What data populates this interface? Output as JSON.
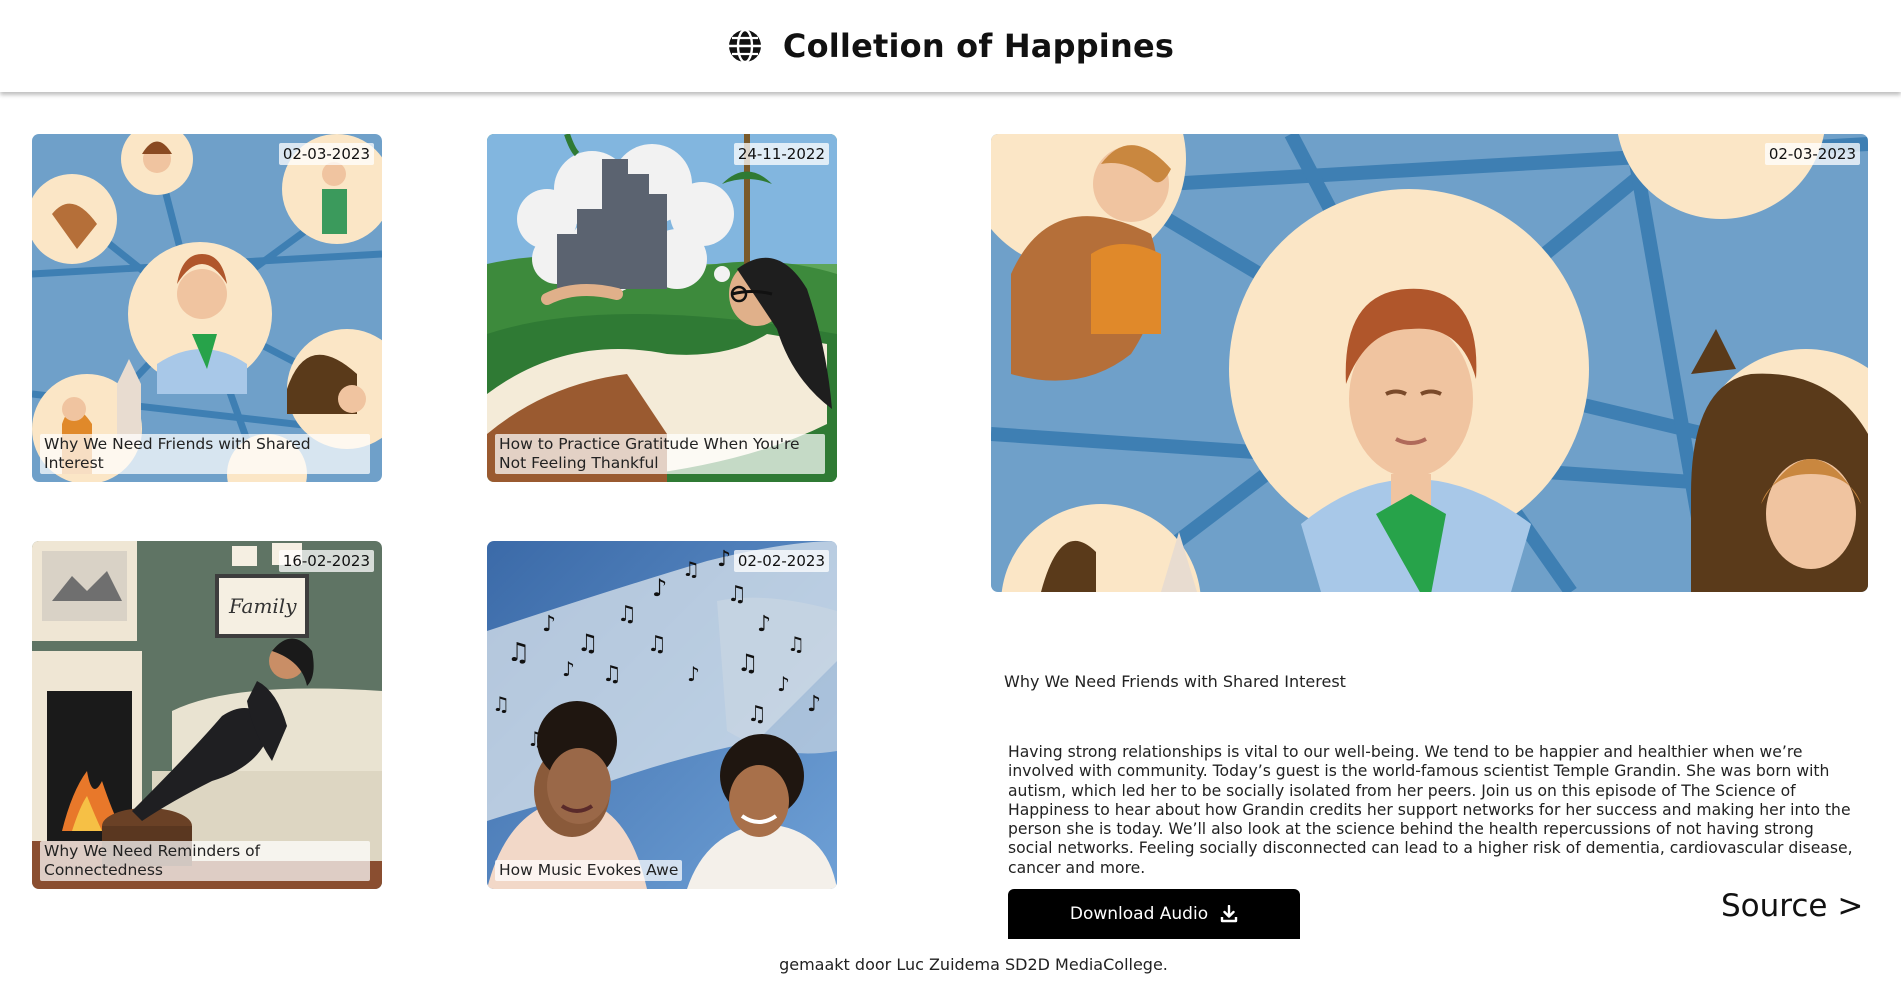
{
  "header": {
    "title": "Colletion of Happines",
    "icon": "globe-icon"
  },
  "cards": [
    {
      "date": "02-03-2023",
      "title": "Why We Need Friends with Shared Interest"
    },
    {
      "date": "24-11-2022",
      "title": "How to Practice Gratitude When You're Not Feeling Thankful"
    },
    {
      "date": "16-02-2023",
      "title": "Why We Need Reminders of Connectedness"
    },
    {
      "date": "02-02-2023",
      "title": "How Music Evokes Awe"
    }
  ],
  "detail": {
    "date": "02-03-2023",
    "title": "Why We Need Friends with Shared Interest",
    "description": "Having strong relationships is vital to our well-being. We tend to be happier and healthier when we’re involved with community. Today’s guest is the world-famous scientist Temple Grandin. She was born with autism, which led her to be socially isolated from her peers. Join us on this episode of The Science of Happiness to hear about how Grandin credits her support networks for her success and making her into the person she is today. We’ll also look at the science behind the health repercussions of not having strong social networks. Feeling socially disconnected can lead to a higher risk of dementia, cardiovascular disease, cancer and more.",
    "download_label": "Download Audio",
    "download_icon": "download-icon",
    "source_label": "Source >"
  },
  "footer": {
    "text": "gemaakt door Luc Zuidema SD2D MediaCollege."
  },
  "colors": {
    "accent": "#000000",
    "sky_blue": "#6fa0c9",
    "green": "#2f7a3c"
  }
}
